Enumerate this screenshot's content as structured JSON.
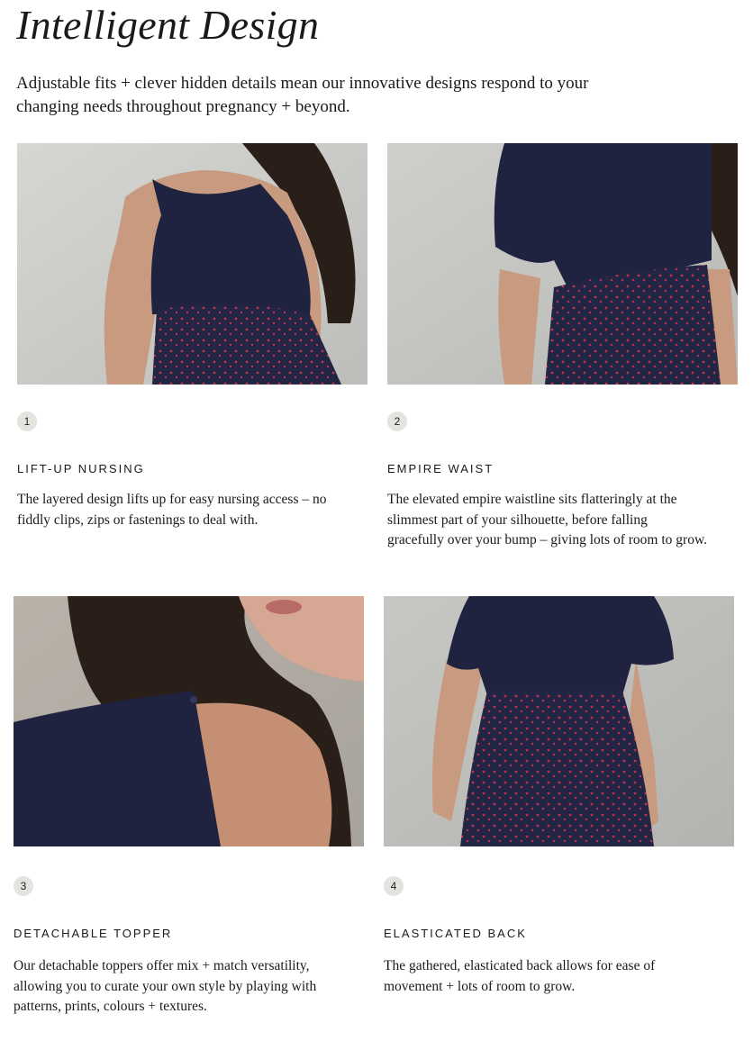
{
  "header": {
    "title": "Intelligent Design",
    "intro": "Adjustable fits + clever hidden details mean our innovative designs respond to your changing needs throughout pregnancy + beyond."
  },
  "features": [
    {
      "number": "1",
      "title": "LIFT-UP NURSING",
      "text": "The layered design lifts up for easy nursing access – no fiddly clips, zips or fastenings to deal with."
    },
    {
      "number": "2",
      "title": "EMPIRE WAIST",
      "text": "The elevated empire waistline sits flatteringly at the slimmest part of your silhouette, before falling gracefully over your bump – giving lots of room to grow."
    },
    {
      "number": "3",
      "title": "DETACHABLE TOPPER",
      "text": "Our detachable toppers offer mix + match versatility, allowing you to curate your own style by playing with patterns, prints, colours + textures."
    },
    {
      "number": "4",
      "title": "ELASTICATED BACK",
      "text": "The gathered, elasticated back allows for ease of movement + lots of room to grow."
    }
  ],
  "colors": {
    "navy": "#1f2340",
    "wall": "#cfcfcc",
    "skin": "#c89a80",
    "print_dot": "#c0314d",
    "badge_bg": "#e5e3dd"
  }
}
